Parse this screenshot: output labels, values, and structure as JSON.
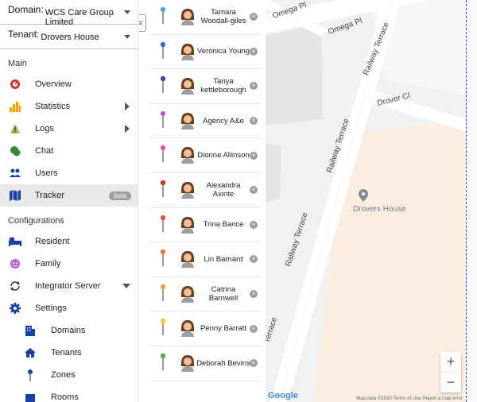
{
  "domain": {
    "label": "Domain:",
    "value": "WCS Care Group Limited"
  },
  "tenant": {
    "label": "Tenant:",
    "value": "Drovers House"
  },
  "sections": {
    "main": "Main",
    "configurations": "Configurations"
  },
  "nav": [
    {
      "label": "Overview",
      "icon": "speedometer-icon"
    },
    {
      "label": "Statistics",
      "icon": "bar-chart-icon"
    },
    {
      "label": "Logs",
      "icon": "warning-icon"
    },
    {
      "label": "Chat",
      "icon": "chat-icon"
    },
    {
      "label": "Users",
      "icon": "users-icon"
    },
    {
      "label": "Tracker",
      "icon": "map-icon",
      "badge": "beta"
    }
  ],
  "config": [
    {
      "label": "Resident",
      "icon": "bed-icon"
    },
    {
      "label": "Family",
      "icon": "family-icon"
    },
    {
      "label": "Integrator Server",
      "icon": "sync-icon"
    },
    {
      "label": "Settings",
      "icon": "gear-icon"
    }
  ],
  "settings_sub": [
    {
      "label": "Domains",
      "icon": "building-icon"
    },
    {
      "label": "Tenants",
      "icon": "house-icon"
    },
    {
      "label": "Zones",
      "icon": "pin-icon"
    },
    {
      "label": "Rooms",
      "icon": "room-icon"
    }
  ],
  "people": [
    {
      "name": "Tamara Woodall-giles",
      "pin_color": "#4fa3e0"
    },
    {
      "name": "Veronica Young",
      "pin_color": "#2f6fd1"
    },
    {
      "name": "Tanya kettleborough",
      "pin_color": "#4a3fb0"
    },
    {
      "name": "Agency A&e",
      "pin_color": "#c05ad6"
    },
    {
      "name": "Dionne Allinson",
      "pin_color": "#e0579a"
    },
    {
      "name": "Alexandra Axinte",
      "pin_color": "#c0392b"
    },
    {
      "name": "Trina Bance",
      "pin_color": "#e0554a"
    },
    {
      "name": "Lin Barnard",
      "pin_color": "#f07a3a"
    },
    {
      "name": "Catrina Barnwell",
      "pin_color": "#f0a23a"
    },
    {
      "name": "Penny Barratt",
      "pin_color": "#f0d23a"
    },
    {
      "name": "Deborah Bevins",
      "pin_color": "#4caf50"
    }
  ],
  "map": {
    "roads": [
      "Omega Pl",
      "Omega Pl",
      "Railway Terrace",
      "Drover Cl",
      "Railway Terrace",
      "Railway Terrace",
      "Terrace"
    ],
    "place": "Drovers House",
    "zoom_in": "+",
    "zoom_out": "−",
    "brand": "Google",
    "credit": "Map data ©2020   Terms of Use   Report a map error"
  },
  "colors": {
    "accent": "#1a3fa6",
    "active_bg": "#e8e8e8",
    "building": "#fbeee1",
    "road": "#ffffff"
  }
}
